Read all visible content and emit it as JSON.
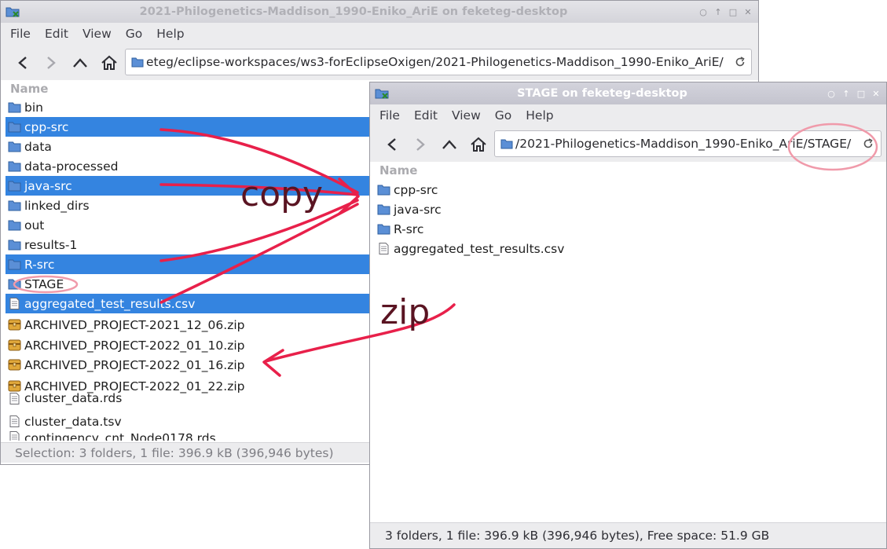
{
  "back_window": {
    "title": "2021-Philogenetics-Maddison_1990-Eniko_AriE on feketeg-desktop",
    "window_buttons": [
      "○",
      "↑",
      "□",
      "✕"
    ],
    "menu": [
      "File",
      "Edit",
      "View",
      "Go",
      "Help"
    ],
    "address": "eteg/eclipse-workspaces/ws3-forEclipseOxigen/2021-Philogenetics-Maddison_1990-Eniko_AriE/",
    "column_header": "Name",
    "items": [
      {
        "name": "bin",
        "type": "folder",
        "selected": false
      },
      {
        "name": "cpp-src",
        "type": "folder",
        "selected": true
      },
      {
        "name": "data",
        "type": "folder",
        "selected": false
      },
      {
        "name": "data-processed",
        "type": "folder",
        "selected": false
      },
      {
        "name": "java-src",
        "type": "folder",
        "selected": true
      },
      {
        "name": "linked_dirs",
        "type": "folder",
        "selected": false
      },
      {
        "name": "out",
        "type": "folder",
        "selected": false
      },
      {
        "name": "results-1",
        "type": "folder",
        "selected": false
      },
      {
        "name": "R-src",
        "type": "folder",
        "selected": true
      },
      {
        "name": "STAGE",
        "type": "folder",
        "selected": false
      },
      {
        "name": "aggregated_test_results.csv",
        "type": "file",
        "selected": true
      },
      {
        "name": "ARCHIVED_PROJECT-2021_12_06.zip",
        "type": "zip",
        "selected": false
      },
      {
        "name": "ARCHIVED_PROJECT-2022_01_10.zip",
        "type": "zip",
        "selected": false
      },
      {
        "name": "ARCHIVED_PROJECT-2022_01_16.zip",
        "type": "zip",
        "selected": false
      },
      {
        "name": "ARCHIVED_PROJECT-2022_01_22.zip",
        "type": "zip",
        "selected": false
      },
      {
        "name": "cluster_data.rds",
        "type": "file",
        "selected": false
      },
      {
        "name": "cluster_data.tsv",
        "type": "file",
        "selected": false
      },
      {
        "name": "contingency_cnt_Node0178.rds",
        "type": "file",
        "selected": false
      }
    ],
    "status": "Selection: 3 folders, 1 file: 396.9  kB (396,946 bytes)"
  },
  "front_window": {
    "title": "STAGE on feketeg-desktop",
    "window_buttons": [
      "○",
      "↑",
      "□",
      "✕"
    ],
    "menu": [
      "File",
      "Edit",
      "View",
      "Go",
      "Help"
    ],
    "address": "/2021-Philogenetics-Maddison_1990-Eniko_AriE/STAGE/",
    "column_header": "Name",
    "items": [
      {
        "name": "cpp-src",
        "type": "folder"
      },
      {
        "name": "java-src",
        "type": "folder"
      },
      {
        "name": "R-src",
        "type": "folder"
      },
      {
        "name": "aggregated_test_results.csv",
        "type": "file"
      }
    ],
    "status": "3 folders, 1 file: 396.9  kB (396,946 bytes), Free space: 51.9  GB"
  },
  "annotations": {
    "copy_label": "copy",
    "zip_label": "zip",
    "arrow_color": "#e8204a",
    "circle_color": "#f09aaa",
    "label_color": "#5a1422"
  },
  "colors": {
    "selection": "#3484e0",
    "folder": "#5b8fd6"
  }
}
